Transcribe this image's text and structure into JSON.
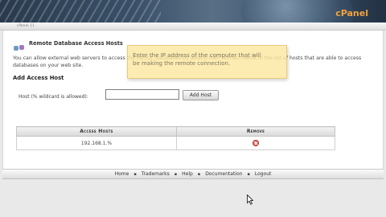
{
  "header": {
    "logo": "cPanel"
  },
  "breadcrumb": "cPanel 11",
  "page": {
    "title": "Remote Database Access Hosts",
    "intro": "You can allow external web servers to access the MySQL databases by adding their domain name to the list of hosts that are able to access databases on your web site.",
    "section_heading": "Add Access Host",
    "host_label": "Host (% wildcard is allowed):",
    "host_value": "",
    "add_button": "Add Host"
  },
  "tooltip": {
    "text_line1": "Enter the IP address of the computer that will",
    "text_line2": "be making the remote connection."
  },
  "table": {
    "headers": [
      "Access Hosts",
      "Remove"
    ],
    "rows": [
      {
        "host": "192.168.1.%",
        "remove_icon": "remove-icon"
      }
    ]
  },
  "footer": {
    "links": [
      "Home",
      "Trademarks",
      "Help",
      "Documentation",
      "Logout"
    ],
    "separator": "▪"
  },
  "colors": {
    "logo": "#f2a23a",
    "tooltip_bg": "#fce8a0",
    "remove_icon": "#d2463c"
  }
}
